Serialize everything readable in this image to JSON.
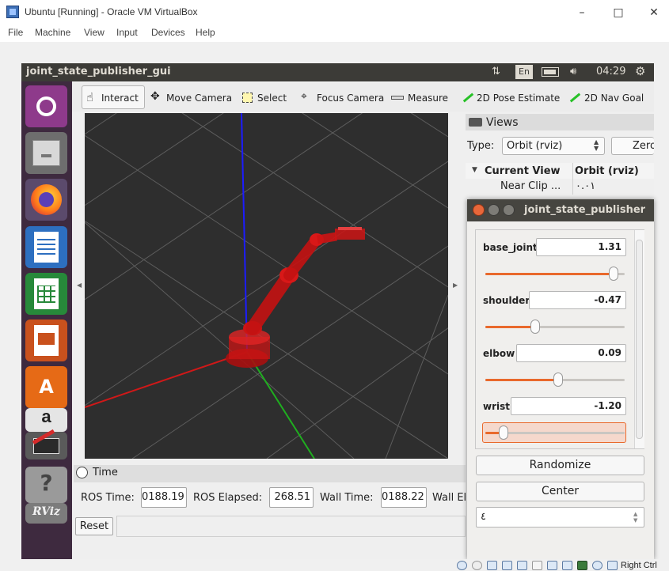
{
  "vbox": {
    "title": "Ubuntu [Running] - Oracle VM VirtualBox",
    "menu": [
      "File",
      "Machine",
      "View",
      "Input",
      "Devices",
      "Help"
    ],
    "window_controls": [
      "–",
      "□",
      "✕"
    ],
    "status_hostkey": "Right Ctrl",
    "status_icons": [
      "hdd-icon",
      "optical-icon",
      "audio-icon",
      "network-icon",
      "usb-icon",
      "shared-folder-icon",
      "display-icon",
      "video-capture-icon",
      "cpu-icon",
      "arrow-icon",
      "mouse-icon"
    ]
  },
  "ubuntu": {
    "panel_title": "joint_state_publisher_gui",
    "keyboard_layout": "En",
    "clock": "04:29",
    "launcher_icons": [
      "ubuntu-dash-icon",
      "files-icon",
      "firefox-icon",
      "writer-icon",
      "calc-icon",
      "impress-icon",
      "software-center-icon",
      "amazon-icon",
      "system-settings-icon",
      "help-icon",
      "rviz-icon"
    ],
    "launcher_labels": {
      "amazon": "a",
      "help": "?",
      "rviz": "RViz",
      "software": "A"
    }
  },
  "rviz": {
    "toolbar": [
      {
        "label": "Interact",
        "icon": "hand-icon"
      },
      {
        "label": "Move Camera",
        "icon": "move-camera-icon"
      },
      {
        "label": "Select",
        "icon": "select-icon"
      },
      {
        "label": "Focus Camera",
        "icon": "focus-camera-icon"
      },
      {
        "label": "Measure",
        "icon": "ruler-icon"
      },
      {
        "label": "2D Pose Estimate",
        "icon": "pose-estimate-icon"
      },
      {
        "label": "2D Nav Goal",
        "icon": "nav-goal-icon"
      }
    ],
    "time_panel": {
      "title": "Time",
      "ros_time_label": "ROS Time:",
      "ros_time": "0188.19",
      "ros_elapsed_label": "ROS Elapsed:",
      "ros_elapsed": "268.51",
      "wall_time_label": "Wall Time:",
      "wall_time": "0188.22",
      "wall_elapsed_label": "Wall El",
      "reset_label": "Reset"
    },
    "views_panel": {
      "title": "Views",
      "type_label": "Type:",
      "type_value": "Orbit (rviz)",
      "zero_label": "Zero",
      "tree_col1": "Current View",
      "tree_col2": "Orbit (rviz)",
      "row_near_clip_label": "Near Clip ...",
      "row_near_clip_value": "٠.٠١"
    }
  },
  "jsp": {
    "title": "joint_state_publisher",
    "joints": [
      {
        "name": "base_joint",
        "value": "1.31",
        "fraction": 0.92
      },
      {
        "name": "shoulder",
        "value": "-0.47",
        "fraction": 0.36
      },
      {
        "name": "elbow",
        "value": "0.09",
        "fraction": 0.52
      },
      {
        "name": "wrist",
        "value": "-1.20",
        "fraction": 0.13
      }
    ],
    "randomize_label": "Randomize",
    "center_label": "Center",
    "spin_value": "٤"
  },
  "colors": {
    "ubuntu_panel": "#3c3b37",
    "launcher": "#3e2a3f",
    "viewport_bg": "#2e2e2e",
    "slider_accent": "#e9692c",
    "robot_red": "#cc1414",
    "axis_x": "#d01818",
    "axis_y": "#1fae1f",
    "axis_z": "#1c1cff"
  }
}
